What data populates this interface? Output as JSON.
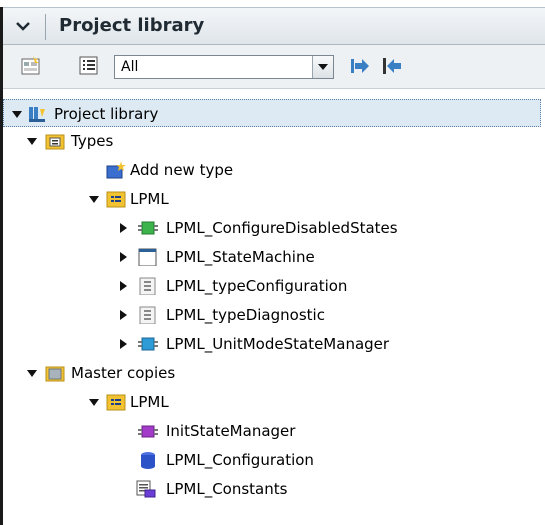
{
  "header": {
    "title": "Project library"
  },
  "toolbar": {
    "filter_value": "All"
  },
  "tree": {
    "project_library": "Project library",
    "types": "Types",
    "add_new_type": "Add new type",
    "types_lpml": "LPML",
    "configure_disabled_states": "LPML_ConfigureDisabledStates",
    "state_machine": "LPML_StateMachine",
    "type_configuration": "LPML_typeConfiguration",
    "type_diagnostic": "LPML_typeDiagnostic",
    "unit_mode_state_manager": "LPML_UnitModeStateManager",
    "master_copies": "Master copies",
    "master_lpml": "LPML",
    "init_state_manager": "InitStateManager",
    "lpml_configuration": "LPML_Configuration",
    "lpml_constants": "LPML_Constants"
  },
  "colors": {
    "folder": "#f2c230",
    "selection": "#dde9f3",
    "header_bg": "#e6ebef"
  }
}
